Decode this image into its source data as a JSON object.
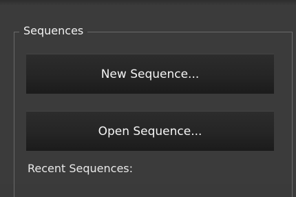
{
  "sequences_panel": {
    "group_title": "Sequences",
    "new_sequence_label": "New Sequence...",
    "open_sequence_label": "Open Sequence...",
    "recent_sequences_label": "Recent Sequences:"
  }
}
